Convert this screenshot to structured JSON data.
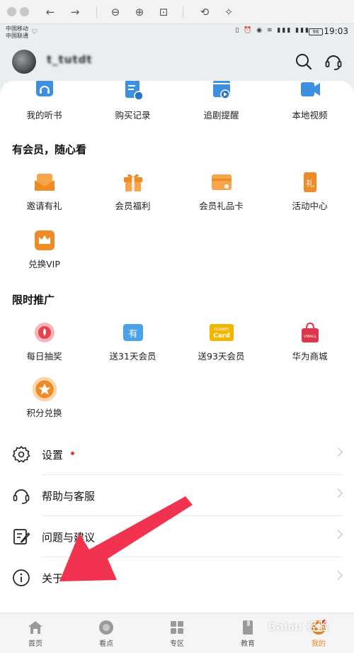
{
  "status": {
    "carrier1": "中国移动",
    "carrier2": "中国联通",
    "battery": "96",
    "time": "19:03"
  },
  "profile": {
    "username": "t_tutdt"
  },
  "top_row": [
    {
      "label": "我的听书",
      "icon": "headphones-icon",
      "color": "#3d8fe0"
    },
    {
      "label": "购买记录",
      "icon": "receipt-icon",
      "color": "#3d8fe0"
    },
    {
      "label": "追剧提醒",
      "icon": "calendar-play-icon",
      "color": "#3d8fe0"
    },
    {
      "label": "本地视频",
      "icon": "video-camera-icon",
      "color": "#3d8fe0"
    }
  ],
  "vip_section": {
    "title": "有会员，随心看",
    "items": [
      {
        "label": "邀请有礼",
        "icon": "invite-envelope-icon",
        "color": "#f08a24"
      },
      {
        "label": "会员福利",
        "icon": "gift-box-icon",
        "color": "#f08a24"
      },
      {
        "label": "会员礼品卡",
        "icon": "gift-card-icon",
        "color": "#f08a24"
      },
      {
        "label": "活动中心",
        "icon": "activity-phone-icon",
        "color": "#f08a24"
      },
      {
        "label": "兑换VIP",
        "icon": "crown-icon",
        "color": "#f08a24"
      }
    ]
  },
  "promo_section": {
    "title": "限时推广",
    "items": [
      {
        "label": "每日抽奖",
        "icon": "lottery-icon",
        "color": "#e8414b"
      },
      {
        "label": "送31天会员",
        "icon": "coupon-icon",
        "color": "#4aa3e8"
      },
      {
        "label": "送93天会员",
        "icon": "huawei-card-icon",
        "color": "#f3b600",
        "badge1": "HUAWEI",
        "badge2": "Card"
      },
      {
        "label": "华为商城",
        "icon": "vmall-bag-icon",
        "color": "#e0344a",
        "badge1": "VMALL"
      },
      {
        "label": "积分兑换",
        "icon": "star-points-icon",
        "color": "#f08a24"
      }
    ]
  },
  "settings_list": [
    {
      "label": "设置",
      "icon": "gear-icon",
      "dot": true
    },
    {
      "label": "帮助与客服",
      "icon": "headset-icon",
      "dot": false
    },
    {
      "label": "问题与建议",
      "icon": "feedback-edit-icon",
      "dot": false
    },
    {
      "label": "关于",
      "icon": "info-icon",
      "dot": false
    }
  ],
  "bottom_nav": [
    {
      "label": "首页",
      "icon": "home-icon"
    },
    {
      "label": "看点",
      "icon": "discover-icon"
    },
    {
      "label": "专区",
      "icon": "grid-icon"
    },
    {
      "label": "教育",
      "icon": "book-icon"
    },
    {
      "label": "我的",
      "icon": "profile-icon",
      "active": true
    }
  ],
  "colors": {
    "accent": "#e8821a",
    "annotation_arrow": "#f2334f"
  }
}
